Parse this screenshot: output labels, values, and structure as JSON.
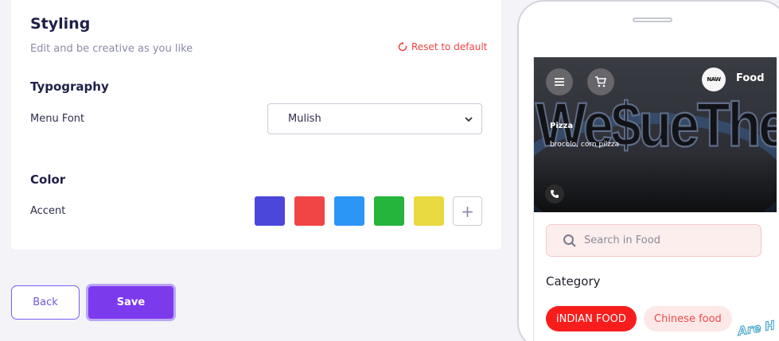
{
  "styling": {
    "title": "Styling",
    "subtitle": "Edit and be creative as you like",
    "reset_label": "Reset to default",
    "typography": {
      "heading": "Typography",
      "menu_font_label": "Menu Font",
      "menu_font_value": "Mulish"
    },
    "color": {
      "heading": "Color",
      "accent_label": "Accent",
      "swatches": [
        "#4b47db",
        "#f14545",
        "#2b96f5",
        "#25b43c",
        "#e8d941"
      ],
      "add_label": "+"
    }
  },
  "actions": {
    "back_label": "Back",
    "save_label": "Save"
  },
  "preview": {
    "hero_text": "We$ueThem",
    "logo_text": "NAW",
    "brand": "Food",
    "item_name": "Pizza",
    "item_desc": "brocolo, corn pilzza",
    "search_placeholder": "Search in Food",
    "category_heading": "Category",
    "categories": [
      {
        "label": "iNDIAN FOOD",
        "active": true
      },
      {
        "label": "Chinese food",
        "active": false
      }
    ]
  },
  "watermark": "Are H"
}
